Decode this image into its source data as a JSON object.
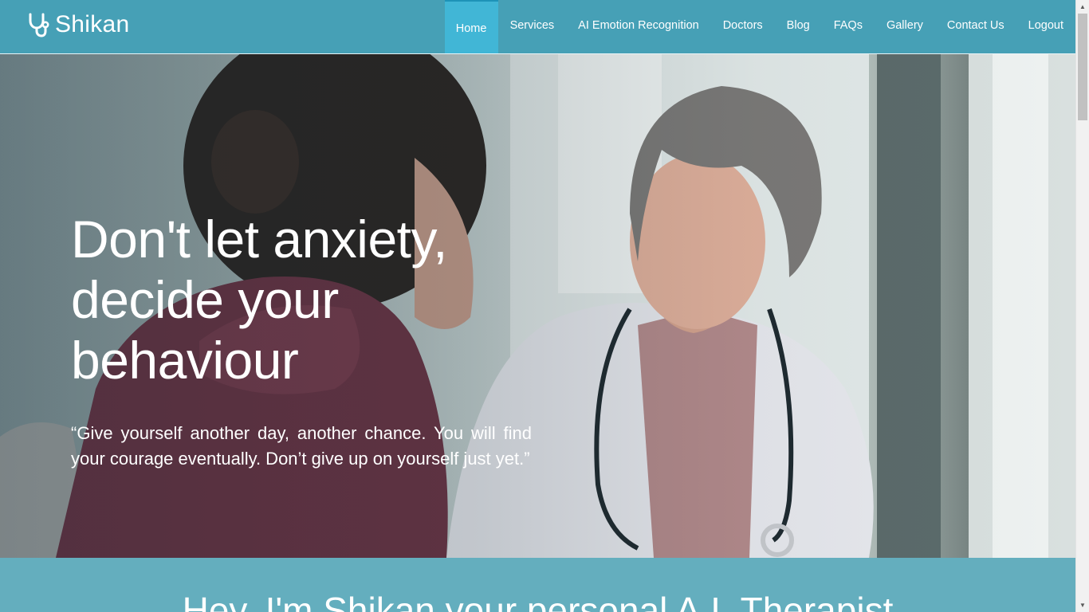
{
  "brand": {
    "name": "Shikan",
    "icon": "stethoscope-icon"
  },
  "nav": {
    "items": [
      {
        "label": "Home",
        "active": true
      },
      {
        "label": "Services"
      },
      {
        "label": "AI Emotion Recognition"
      },
      {
        "label": "Doctors"
      },
      {
        "label": "Blog"
      },
      {
        "label": "FAQs"
      },
      {
        "label": "Gallery"
      },
      {
        "label": "Contact Us"
      },
      {
        "label": "Logout"
      }
    ]
  },
  "hero": {
    "title": "Don't let anxiety, decide your behaviour",
    "quote": "“Give yourself another day, another chance. You will find your courage eventually. Don’t give up on yourself just yet.”"
  },
  "intro": {
    "heading": "Hey, I'm Shikan your personal A.I. Therapist"
  },
  "colors": {
    "navbar": "#46a0b6",
    "nav_active": "#41b6d6",
    "intro_background": "#64aebe",
    "text": "#ffffff"
  }
}
